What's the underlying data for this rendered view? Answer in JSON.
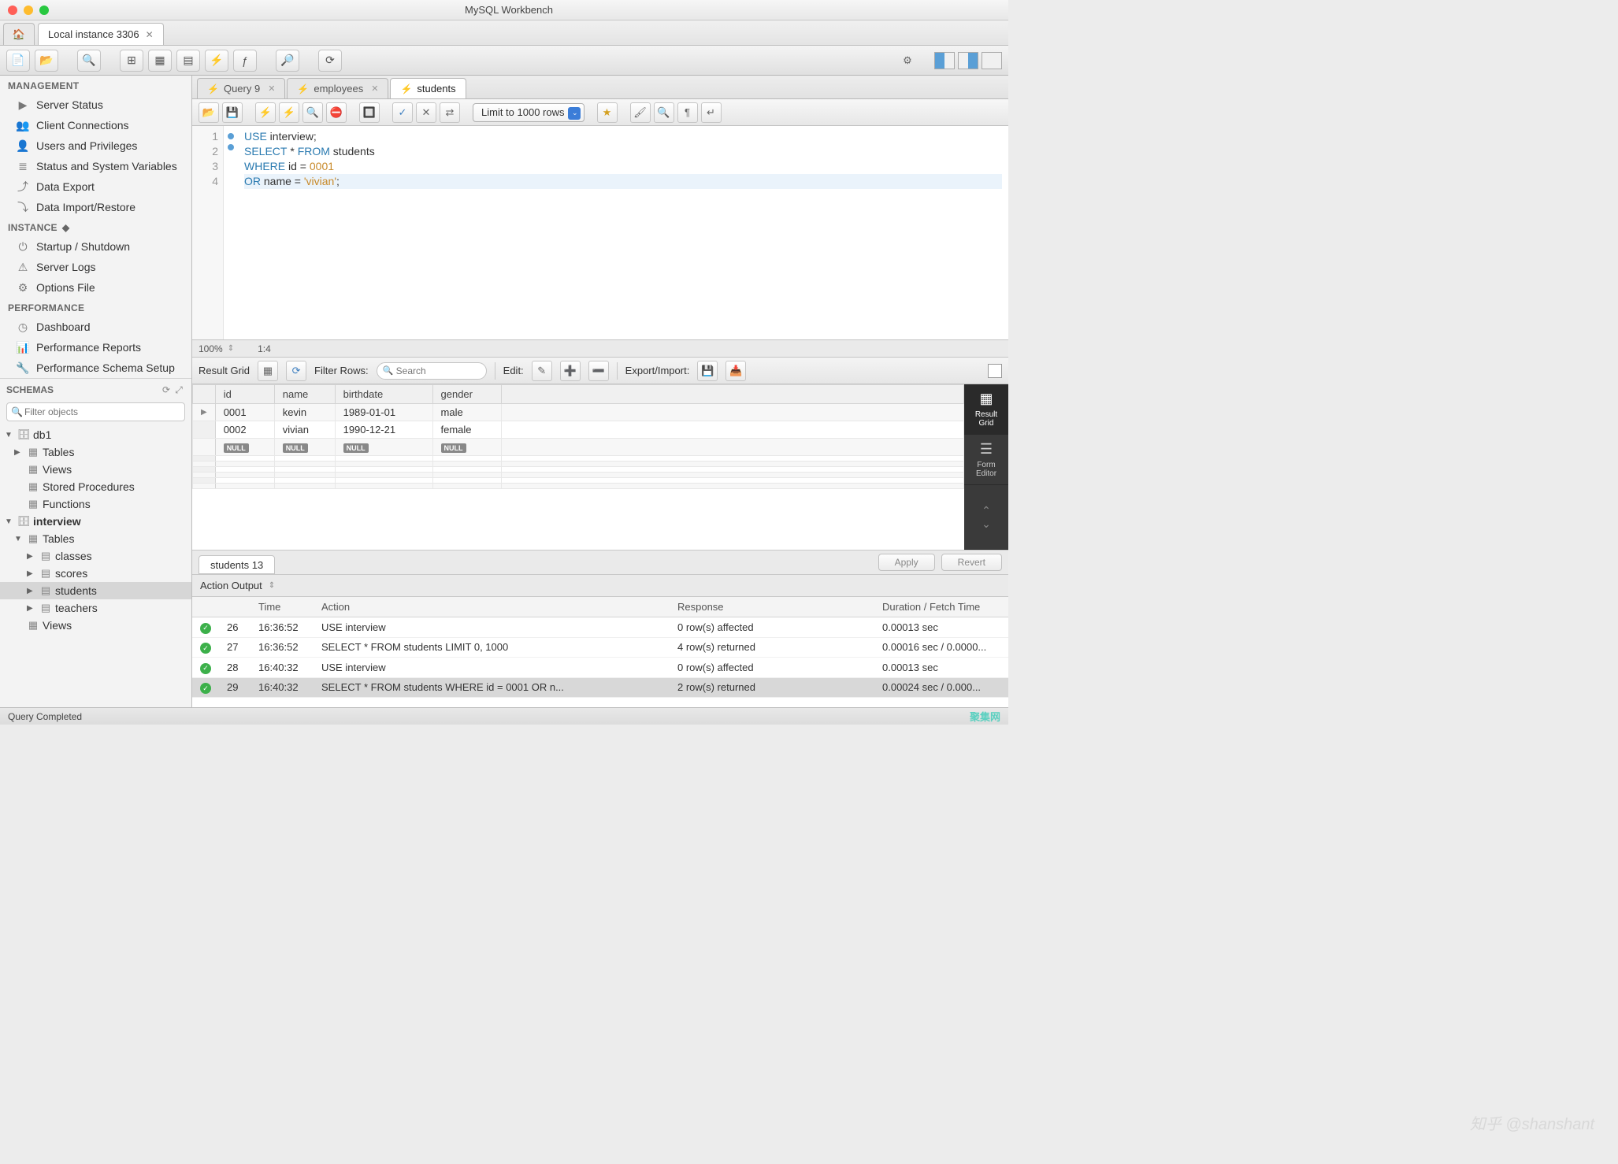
{
  "app_title": "MySQL Workbench",
  "connection_tab": "Local instance 3306",
  "sidebar": {
    "management_label": "MANAGEMENT",
    "management": [
      {
        "label": "Server Status",
        "icon": "▶"
      },
      {
        "label": "Client Connections",
        "icon": "👥"
      },
      {
        "label": "Users and Privileges",
        "icon": "👤"
      },
      {
        "label": "Status and System Variables",
        "icon": "≣"
      },
      {
        "label": "Data Export",
        "icon": "⤴"
      },
      {
        "label": "Data Import/Restore",
        "icon": "⤵"
      }
    ],
    "instance_label": "INSTANCE",
    "instance": [
      {
        "label": "Startup / Shutdown",
        "icon": "⏻"
      },
      {
        "label": "Server Logs",
        "icon": "⚠"
      },
      {
        "label": "Options File",
        "icon": "⚙"
      }
    ],
    "performance_label": "PERFORMANCE",
    "performance": [
      {
        "label": "Dashboard",
        "icon": "◷"
      },
      {
        "label": "Performance Reports",
        "icon": "📊"
      },
      {
        "label": "Performance Schema Setup",
        "icon": "🔧"
      }
    ],
    "schemas_label": "SCHEMAS",
    "filter_placeholder": "Filter objects"
  },
  "tree": {
    "db1": {
      "name": "db1",
      "children": [
        "Tables",
        "Views",
        "Stored Procedures",
        "Functions"
      ]
    },
    "interview": {
      "name": "interview",
      "tables_label": "Tables",
      "tables": [
        "classes",
        "scores",
        "students",
        "teachers"
      ],
      "views_label": "Views"
    }
  },
  "query_tabs": [
    {
      "label": "Query 9"
    },
    {
      "label": "employees"
    },
    {
      "label": "students"
    }
  ],
  "limit_label": "Limit to 1000 rows",
  "editor": {
    "lines": [
      "1",
      "2",
      "3",
      "4"
    ],
    "code1_kw1": "USE",
    "code1_rest": " interview;",
    "code2_kw1": "SELECT",
    "code2_star": " * ",
    "code2_kw2": "FROM",
    "code2_rest": " students",
    "code3_kw1": "WHERE",
    "code3_mid": " id = ",
    "code3_num": "0001",
    "code4_kw1": "OR",
    "code4_mid": " name = ",
    "code4_str": "'vivian'",
    "code4_end": ";"
  },
  "status": {
    "zoom": "100%",
    "pos": "1:4"
  },
  "result_toolbar": {
    "label": "Result Grid",
    "filter_label": "Filter Rows:",
    "search_placeholder": "Search",
    "edit_label": "Edit:",
    "export_label": "Export/Import:"
  },
  "grid": {
    "columns": [
      "id",
      "name",
      "birthdate",
      "gender"
    ],
    "rows": [
      {
        "id": "0001",
        "name": "kevin",
        "birthdate": "1989-01-01",
        "gender": "male"
      },
      {
        "id": "0002",
        "name": "vivian",
        "birthdate": "1990-12-21",
        "gender": "female"
      }
    ],
    "null_label": "NULL"
  },
  "side_tools": {
    "result_grid": "Result\nGrid",
    "form_editor": "Form\nEditor"
  },
  "bottom_tab": "students 13",
  "apply_label": "Apply",
  "revert_label": "Revert",
  "output_label": "Action Output",
  "output_cols": {
    "n": "",
    "time": "Time",
    "action": "Action",
    "response": "Response",
    "duration": "Duration / Fetch Time"
  },
  "output_rows": [
    {
      "n": "26",
      "time": "16:36:52",
      "action": "USE interview",
      "response": "0 row(s) affected",
      "duration": "0.00013 sec"
    },
    {
      "n": "27",
      "time": "16:36:52",
      "action": "SELECT * FROM students LIMIT 0, 1000",
      "response": "4 row(s) returned",
      "duration": "0.00016 sec / 0.0000..."
    },
    {
      "n": "28",
      "time": "16:40:32",
      "action": "USE interview",
      "response": "0 row(s) affected",
      "duration": "0.00013 sec"
    },
    {
      "n": "29",
      "time": "16:40:32",
      "action": "SELECT * FROM students WHERE id = 0001  OR n...",
      "response": "2 row(s) returned",
      "duration": "0.00024 sec / 0.000..."
    }
  ],
  "footer_status": "Query Completed",
  "footer_brand": "聚集网",
  "watermark": "知乎 @shanshant"
}
